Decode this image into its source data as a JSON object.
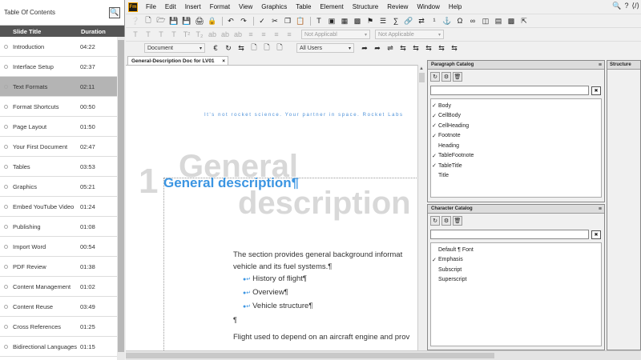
{
  "toc": {
    "title": "Table Of Contents",
    "col_title": "Slide Title",
    "col_duration": "Duration",
    "items": [
      {
        "title": "Introduction",
        "duration": "04:22"
      },
      {
        "title": "Interface Setup",
        "duration": "02:37"
      },
      {
        "title": "Text Formats",
        "duration": "02:11"
      },
      {
        "title": "Format Shortcuts",
        "duration": "00:50"
      },
      {
        "title": "Page Layout",
        "duration": "01:50"
      },
      {
        "title": "Your First Document",
        "duration": "02:47"
      },
      {
        "title": "Tables",
        "duration": "03:53"
      },
      {
        "title": "Graphics",
        "duration": "05:21"
      },
      {
        "title": "Embed YouTube Video",
        "duration": "01:24"
      },
      {
        "title": "Publishing",
        "duration": "01:08"
      },
      {
        "title": "Import Word",
        "duration": "00:54"
      },
      {
        "title": "PDF Review",
        "duration": "01:38"
      },
      {
        "title": "Content Management",
        "duration": "01:02"
      },
      {
        "title": "Content Reuse",
        "duration": "03:49"
      },
      {
        "title": "Cross References",
        "duration": "01:25"
      },
      {
        "title": "Bidirectional Languages",
        "duration": "01:15"
      }
    ],
    "active_index": 2
  },
  "app": {
    "logo": "Fm",
    "menu": [
      "File",
      "Edit",
      "Insert",
      "Format",
      "View",
      "Graphics",
      "Table",
      "Element",
      "Structure",
      "Review",
      "Window",
      "Help"
    ],
    "toolbar": {
      "dd1": "Not Applicabl",
      "dd2": "Not Applicable",
      "dd3": "Document",
      "dd4": "All Users"
    },
    "doc_tab": "General-Description Doc for LV01",
    "doc_tab_close": "×"
  },
  "document": {
    "header_line": "It's not rocket science. Your partner in space. Rocket Labs",
    "ghost_number": "1",
    "ghost_word1": "General",
    "ghost_word2": "description",
    "heading": "General description¶",
    "body": "The section provides general background informat vehicle and its fuel systems.¶",
    "bullets": [
      "History of flight¶",
      "Overview¶",
      "Vehicle structure¶"
    ],
    "para_mark": "¶",
    "flight_line": "Flight used to depend on an aircraft engine and prov"
  },
  "paragraph_catalog": {
    "title": "Paragraph Catalog",
    "items": [
      {
        "name": "Body",
        "checked": true
      },
      {
        "name": "CellBody",
        "checked": true
      },
      {
        "name": "CellHeading",
        "checked": true
      },
      {
        "name": "Footnote",
        "checked": true
      },
      {
        "name": "Heading",
        "checked": false
      },
      {
        "name": "TableFootnote",
        "checked": true
      },
      {
        "name": "TableTitle",
        "checked": true
      },
      {
        "name": "Title",
        "checked": false
      }
    ]
  },
  "character_catalog": {
    "title": "Character Catalog",
    "items": [
      {
        "name": "Default ¶ Font",
        "checked": false
      },
      {
        "name": "Emphasis",
        "checked": true
      },
      {
        "name": "Subscript",
        "checked": false
      },
      {
        "name": "Superscript",
        "checked": false
      }
    ]
  },
  "structure_panel": {
    "title": "Structure"
  },
  "colors": {
    "heading_blue": "#3b95e2",
    "toc_active": "#b4b4b4",
    "ghost_gray": "#d8d8d8"
  }
}
